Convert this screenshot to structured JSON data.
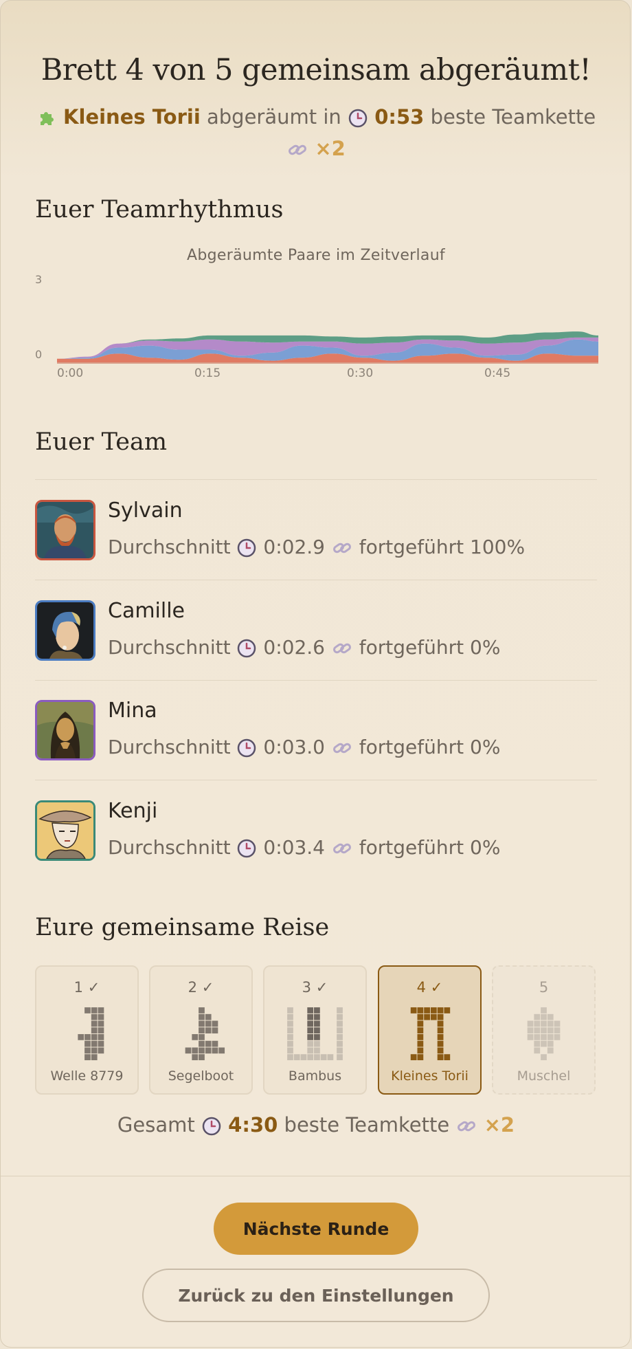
{
  "header": {
    "title": "Brett 4 von 5 gemeinsam abgeräumt!",
    "board_name": "Kleines Torii",
    "cleared_in_label": "abgeräumt in",
    "time": "0:53",
    "best_chain_label": "beste Teamkette",
    "best_chain": "×2"
  },
  "rhythm": {
    "heading": "Euer Teamrhythmus",
    "chart_data": {
      "type": "area",
      "stacked": true,
      "title": "Abgeräumte Paare im Zeitverlauf",
      "xlabel": "",
      "ylabel": "",
      "x_ticks": [
        "0:00",
        "0:15",
        "0:30",
        "0:45"
      ],
      "y_ticks": [
        "0",
        "3"
      ],
      "ylim": [
        0,
        3
      ],
      "x": [
        0,
        3,
        6,
        9,
        12,
        15,
        18,
        21,
        24,
        27,
        30,
        33,
        36,
        39,
        42,
        45,
        48,
        51,
        53
      ],
      "series": [
        {
          "color": "#e07a63",
          "values": [
            0.25,
            0.25,
            0.5,
            0.3,
            0.2,
            0.5,
            0.3,
            0.15,
            0.3,
            0.5,
            0.3,
            0.15,
            0.4,
            0.5,
            0.3,
            0.15,
            0.5,
            0.4,
            0.4
          ]
        },
        {
          "color": "#7b9fd4",
          "values": [
            0,
            0.05,
            0.3,
            0.6,
            0.5,
            0.2,
            0.1,
            0.4,
            0.6,
            0.3,
            0.1,
            0.4,
            0.6,
            0.3,
            0.1,
            0.3,
            0.4,
            0.8,
            0.7
          ]
        },
        {
          "color": "#b48ac9",
          "values": [
            0,
            0.05,
            0.2,
            0.25,
            0.4,
            0.5,
            0.7,
            0.5,
            0.2,
            0.3,
            0.6,
            0.5,
            0.2,
            0.35,
            0.6,
            0.6,
            0.3,
            0.1,
            0.2
          ]
        },
        {
          "color": "#5e9e86",
          "values": [
            0,
            0,
            0,
            0.05,
            0.15,
            0.2,
            0.3,
            0.35,
            0.3,
            0.25,
            0.3,
            0.3,
            0.2,
            0.25,
            0.3,
            0.4,
            0.35,
            0.3,
            0.1
          ]
        }
      ]
    }
  },
  "team": {
    "heading": "Euer Team",
    "avg_label": "Durchschnitt",
    "continued_label": "fortgeführt",
    "members": [
      {
        "name": "Sylvain",
        "avg": "0:02.9",
        "continued": "100%",
        "border": "#c8553f"
      },
      {
        "name": "Camille",
        "avg": "0:02.6",
        "continued": "0%",
        "border": "#4a7bc1"
      },
      {
        "name": "Mina",
        "avg": "0:03.0",
        "continued": "0%",
        "border": "#8a5bbf"
      },
      {
        "name": "Kenji",
        "avg": "0:03.4",
        "continued": "0%",
        "border": "#3a8a78"
      }
    ]
  },
  "journey": {
    "heading": "Eure gemeinsame Reise",
    "boards": [
      {
        "num": "1 ✓",
        "name": "Welle 8779",
        "state": "done"
      },
      {
        "num": "2 ✓",
        "name": "Segelboot",
        "state": "done"
      },
      {
        "num": "3 ✓",
        "name": "Bambus",
        "state": "done"
      },
      {
        "num": "4 ✓",
        "name": "Kleines Torii",
        "state": "active"
      },
      {
        "num": "5",
        "name": "Muschel",
        "state": "pending"
      }
    ],
    "total_label": "Gesamt",
    "total_time": "4:30",
    "best_chain_label": "beste Teamkette",
    "best_chain": "×2"
  },
  "actions": {
    "next_label": "Nächste Runde",
    "back_label": "Zurück zu den Einstellungen"
  },
  "icons": {
    "puzzle": "puzzle-icon",
    "clock": "clock-icon",
    "chain": "link-icon"
  }
}
